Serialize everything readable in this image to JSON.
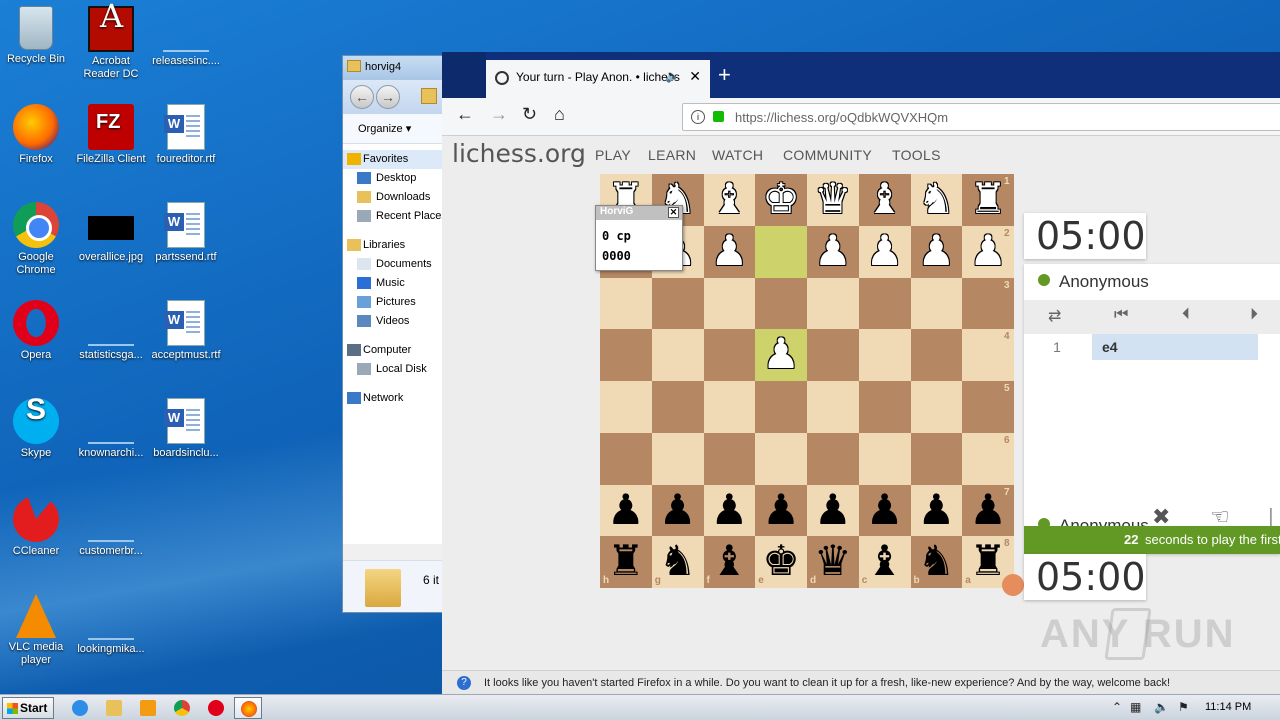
{
  "desktop": {
    "icons": [
      {
        "label": "Recycle Bin",
        "icon": "recycle-bin-icon"
      },
      {
        "label": "Acrobat Reader DC",
        "icon": "acrobat-icon"
      },
      {
        "label": "releasesinc....",
        "icon": "file-icon"
      },
      {
        "label": "Firefox",
        "icon": "firefox-icon"
      },
      {
        "label": "FileZilla Client",
        "icon": "filezilla-icon"
      },
      {
        "label": "foureditor.rtf",
        "icon": "word-doc-icon"
      },
      {
        "label": "Google Chrome",
        "icon": "chrome-icon"
      },
      {
        "label": "overallice.jpg",
        "icon": "image-file-icon"
      },
      {
        "label": "partssend.rtf",
        "icon": "word-doc-icon"
      },
      {
        "label": "Opera",
        "icon": "opera-icon"
      },
      {
        "label": "statisticsga...",
        "icon": "file-icon"
      },
      {
        "label": "acceptmust.rtf",
        "icon": "word-doc-icon"
      },
      {
        "label": "Skype",
        "icon": "skype-icon"
      },
      {
        "label": "knownarchi...",
        "icon": "file-icon"
      },
      {
        "label": "boardsinclu...",
        "icon": "word-doc-icon"
      },
      {
        "label": "CCleaner",
        "icon": "ccleaner-icon"
      },
      {
        "label": "customerbr...",
        "icon": "file-icon"
      },
      {
        "label": "VLC media player",
        "icon": "vlc-icon"
      },
      {
        "label": "lookingmika...",
        "icon": "file-icon"
      }
    ]
  },
  "explorer": {
    "title": "horvig4",
    "organize": "Organize",
    "organize_arrow": "▾",
    "tree": [
      {
        "label": "Favorites"
      },
      {
        "label": "Desktop"
      },
      {
        "label": "Downloads"
      },
      {
        "label": "Recent Places"
      },
      {
        "label": "Libraries"
      },
      {
        "label": "Documents"
      },
      {
        "label": "Music"
      },
      {
        "label": "Pictures"
      },
      {
        "label": "Videos"
      },
      {
        "label": "Computer"
      },
      {
        "label": "Local Disk"
      },
      {
        "label": "Network"
      }
    ],
    "footer": "6 it"
  },
  "browser": {
    "tab_title": "Your turn - Play Anon. • lichess",
    "url_host": "https://lichess.org",
    "url_path": "/oQdbkWQVXHQm",
    "site": {
      "logo": "lichess.org",
      "menu": [
        "PLAY",
        "LEARN",
        "WATCH",
        "COMMUNITY",
        "TOOLS"
      ]
    },
    "notice": "It looks like you haven't started Firefox in a while. Do you want to clean it up for a fresh, like-new experience? And by the way, welcome back!"
  },
  "game": {
    "ranks": [
      "1",
      "2",
      "3",
      "4",
      "5",
      "6",
      "7",
      "8"
    ],
    "files": [
      "h",
      "g",
      "f",
      "e",
      "d",
      "c",
      "b",
      "a"
    ],
    "board": [
      [
        "wR",
        "wN",
        "wB",
        "wK",
        "wQ",
        "wB",
        "wN",
        "wR"
      ],
      [
        "wP",
        "wP",
        "wP",
        "",
        "wP",
        "wP",
        "wP",
        "wP"
      ],
      [
        "",
        "",
        "",
        "",
        "",
        "",
        "",
        ""
      ],
      [
        "",
        "",
        "",
        "wP",
        "",
        "",
        "",
        ""
      ],
      [
        "",
        "",
        "",
        "",
        "",
        "",
        "",
        ""
      ],
      [
        "",
        "",
        "",
        "",
        "",
        "",
        "",
        ""
      ],
      [
        "bP",
        "bP",
        "bP",
        "bP",
        "bP",
        "bP",
        "bP",
        "bP"
      ],
      [
        "bR",
        "bN",
        "bB",
        "bK",
        "bQ",
        "bB",
        "bN",
        "bR"
      ]
    ],
    "last_move": {
      "from": [
        1,
        3
      ],
      "to": [
        3,
        3
      ]
    },
    "eval_popup": {
      "title": "HorviG",
      "score": "0 cp",
      "nodes": "0000"
    },
    "top_clock": "05:00",
    "bottom_clock": "05:00",
    "top_player": "Anonymous",
    "bottom_player": "Anonymous",
    "moves": [
      {
        "no": "1",
        "san": "e4"
      }
    ],
    "timer_number": "22",
    "timer_text": "seconds to play the first move"
  },
  "taskbar": {
    "start": "Start",
    "time": "11:14 PM"
  },
  "watermark": "ANY  RUN"
}
